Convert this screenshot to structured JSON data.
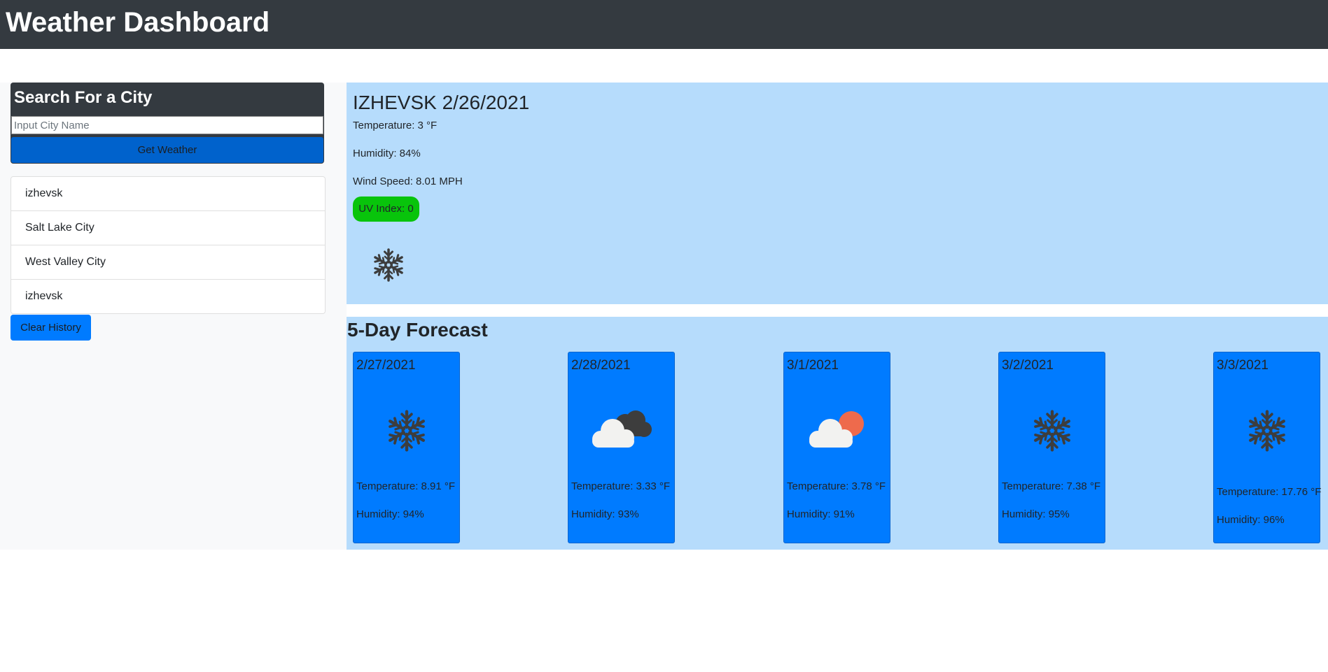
{
  "header": {
    "title": "Weather Dashboard"
  },
  "search": {
    "heading": "Search For a City",
    "placeholder": "Input City Name",
    "value": "",
    "button_label": "Get Weather"
  },
  "history": {
    "items": [
      {
        "label": "izhevsk"
      },
      {
        "label": "Salt Lake City"
      },
      {
        "label": "West Valley City"
      },
      {
        "label": "izhevsk"
      }
    ],
    "clear_label": "Clear History"
  },
  "current": {
    "title": "IZHEVSK 2/26/2021",
    "temperature": "Temperature: 3 °F",
    "humidity": "Humidity: 84%",
    "wind": "Wind Speed: 8.01 MPH",
    "uv": "UV Index: 0",
    "uv_color": "#08c40b",
    "icon": "snow-icon"
  },
  "forecast": {
    "title": "5-Day Forecast",
    "days": [
      {
        "date": "2/27/2021",
        "icon": "snow-icon",
        "temperature": "Temperature: 8.91 °F",
        "humidity": "Humidity: 94%"
      },
      {
        "date": "2/28/2021",
        "icon": "cloudy-night-icon",
        "temperature": "Temperature: 3.33 °F",
        "humidity": "Humidity: 93%"
      },
      {
        "date": "3/1/2021",
        "icon": "partly-cloudy-icon",
        "temperature": "Temperature: 3.78 °F",
        "humidity": "Humidity: 91%"
      },
      {
        "date": "3/2/2021",
        "icon": "snow-icon",
        "temperature": "Temperature: 7.38 °F",
        "humidity": "Humidity: 95%"
      },
      {
        "date": "3/3/2021",
        "icon": "snow-icon",
        "temperature": "Temperature: 17.76 °F",
        "humidity": "Humidity: 96%"
      }
    ]
  },
  "colors": {
    "navbar": "#343a40",
    "panel_background": "#b6dcfc",
    "primary": "#007bff",
    "search_button": "#0062cc"
  }
}
